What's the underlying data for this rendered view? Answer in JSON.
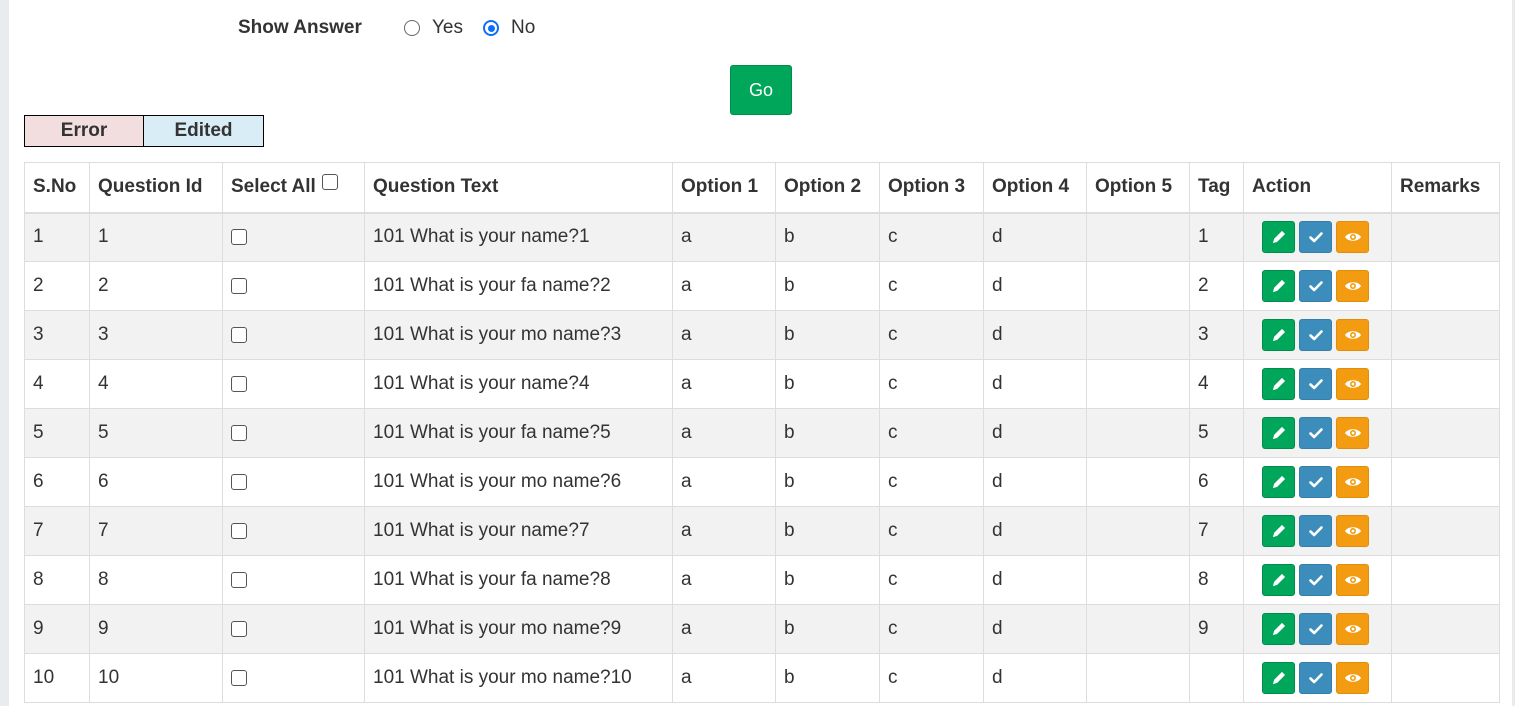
{
  "filter": {
    "show_answer_label": "Show Answer",
    "options": [
      {
        "label": "Yes",
        "selected": false
      },
      {
        "label": "No",
        "selected": true
      }
    ],
    "go_label": "Go"
  },
  "legend": {
    "error_label": "Error",
    "edited_label": "Edited",
    "error_color": "#f2dede",
    "edited_color": "#d9edf7"
  },
  "table": {
    "headers": {
      "sno": "S.No",
      "question_id": "Question Id",
      "select_all": "Select All",
      "question_text": "Question Text",
      "option1": "Option 1",
      "option2": "Option 2",
      "option3": "Option 3",
      "option4": "Option 4",
      "option5": "Option 5",
      "tag": "Tag",
      "action": "Action",
      "remarks": "Remarks"
    },
    "rows": [
      {
        "sno": "1",
        "qid": "1",
        "text": "101 What is your name?1",
        "o1": "a",
        "o2": "b",
        "o3": "c",
        "o4": "d",
        "o5": "",
        "tag": "1",
        "remarks": ""
      },
      {
        "sno": "2",
        "qid": "2",
        "text": "101 What is your fa name?2",
        "o1": "a",
        "o2": "b",
        "o3": "c",
        "o4": "d",
        "o5": "",
        "tag": "2",
        "remarks": ""
      },
      {
        "sno": "3",
        "qid": "3",
        "text": "101 What is your mo name?3",
        "o1": "a",
        "o2": "b",
        "o3": "c",
        "o4": "d",
        "o5": "",
        "tag": "3",
        "remarks": ""
      },
      {
        "sno": "4",
        "qid": "4",
        "text": "101 What is your name?4",
        "o1": "a",
        "o2": "b",
        "o3": "c",
        "o4": "d",
        "o5": "",
        "tag": "4",
        "remarks": ""
      },
      {
        "sno": "5",
        "qid": "5",
        "text": "101 What is your fa name?5",
        "o1": "a",
        "o2": "b",
        "o3": "c",
        "o4": "d",
        "o5": "",
        "tag": "5",
        "remarks": ""
      },
      {
        "sno": "6",
        "qid": "6",
        "text": "101 What is your mo name?6",
        "o1": "a",
        "o2": "b",
        "o3": "c",
        "o4": "d",
        "o5": "",
        "tag": "6",
        "remarks": ""
      },
      {
        "sno": "7",
        "qid": "7",
        "text": "101 What is your name?7",
        "o1": "a",
        "o2": "b",
        "o3": "c",
        "o4": "d",
        "o5": "",
        "tag": "7",
        "remarks": ""
      },
      {
        "sno": "8",
        "qid": "8",
        "text": "101 What is your fa name?8",
        "o1": "a",
        "o2": "b",
        "o3": "c",
        "o4": "d",
        "o5": "",
        "tag": "8",
        "remarks": ""
      },
      {
        "sno": "9",
        "qid": "9",
        "text": "101 What is your mo name?9",
        "o1": "a",
        "o2": "b",
        "o3": "c",
        "o4": "d",
        "o5": "",
        "tag": "9",
        "remarks": ""
      },
      {
        "sno": "10",
        "qid": "10",
        "text": "101 What is your mo name?10",
        "o1": "a",
        "o2": "b",
        "o3": "c",
        "o4": "d",
        "o5": "",
        "tag": "",
        "remarks": ""
      }
    ],
    "action_icons": [
      "pencil-icon",
      "check-icon",
      "eye-icon"
    ],
    "action_colors": {
      "edit": "#00a65a",
      "approve": "#3c8dbc",
      "view": "#f39c12"
    }
  }
}
